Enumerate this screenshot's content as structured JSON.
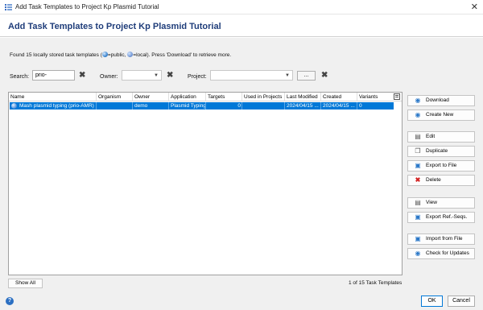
{
  "window": {
    "title": "Add Task Templates to Project Kp Plasmid Tutorial",
    "close_glyph": "✕"
  },
  "header": {
    "heading": "Add Task Templates to Project Kp Plasmid Tutorial"
  },
  "info": {
    "part1": "Found 15 locally stored task templates (",
    "part2": "=public,",
    "part3": "=local). Press 'Download' to retrieve more."
  },
  "filters": {
    "search_label": "Search:",
    "search_value": "prio-",
    "owner_label": "Owner:",
    "owner_value": "",
    "project_label": "Project:",
    "project_value": "",
    "ellipsis_label": "...",
    "clear_glyph": "✖"
  },
  "table": {
    "columns": [
      "Name",
      "Organism",
      "Owner",
      "Application",
      "Targets",
      "Used in Projects",
      "Last Modified",
      "Created",
      "Variants"
    ],
    "rows": [
      {
        "name": "Mash plasmid typing (prio-AMR)",
        "organism": "",
        "owner": "demo",
        "application": "Plasmid Typing",
        "targets": "0",
        "used_in_projects": "",
        "last_modified": "2024/04/15 ...",
        "created": "2024/04/15 ...",
        "variants": "0"
      }
    ]
  },
  "actions": {
    "download": "Download",
    "create_new": "Create New",
    "edit": "Edit",
    "duplicate": "Duplicate",
    "export_to_file": "Export to File",
    "delete": "Delete",
    "view": "View",
    "export_ref_seqs": "Export Ref.-Seqs.",
    "import_from_file": "Import from File",
    "check_for_updates": "Check for Updates"
  },
  "footer": {
    "show_all": "Show All",
    "count": "1 of 15 Task Templates",
    "ok": "OK",
    "cancel": "Cancel",
    "help_glyph": "?"
  },
  "colors": {
    "selection": "#0078d7",
    "heading": "#1f3d7a",
    "delete_icon": "#d32020"
  }
}
